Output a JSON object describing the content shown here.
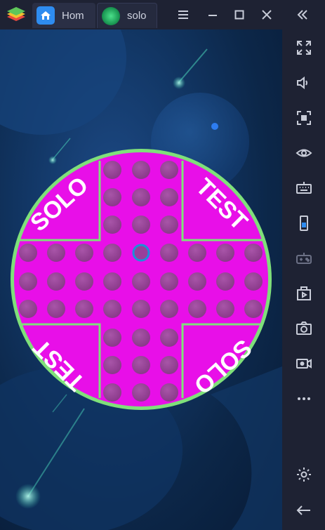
{
  "titlebar": {
    "tabs": [
      {
        "label": "Hom",
        "icon": "home-icon"
      },
      {
        "label": "solo",
        "icon": "game-ball-icon"
      }
    ],
    "controls": [
      "menu-icon",
      "minimize-icon",
      "maximize-icon",
      "close-icon",
      "collapse-sidebar-icon"
    ]
  },
  "sidebar": {
    "buttons": [
      "fullscreen-icon",
      "volume-icon",
      "screenshot-region-icon",
      "eye-icon",
      "keyboard-icon",
      "phone-rotate-icon",
      "gamepad-icon",
      "apk-install-icon",
      "camera-icon",
      "record-icon",
      "more-icon",
      "settings-icon",
      "back-icon"
    ]
  },
  "board": {
    "labels": {
      "top_left": "SOLO",
      "top_right": "TEST",
      "bottom_left": "TEST",
      "bottom_right": "SOLO"
    },
    "colors": {
      "board": "#e80fe8",
      "rim": "#7fe07a",
      "peg": "#9a3f9a",
      "empty_hole_ring": "#1e8fd8"
    },
    "empty_hole": {
      "row": 3,
      "col": 4
    }
  }
}
